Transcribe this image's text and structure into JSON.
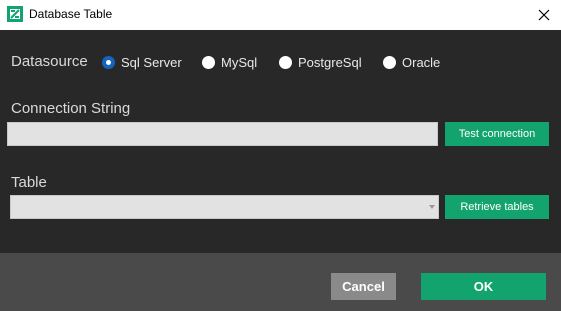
{
  "window": {
    "title": "Database Table",
    "close_icon": "close-icon",
    "app_icon": "app-logo-icon"
  },
  "datasource": {
    "label": "Datasource",
    "options": [
      {
        "label": "Sql Server",
        "checked": true
      },
      {
        "label": "MySql",
        "checked": false
      },
      {
        "label": "PostgreSql",
        "checked": false
      },
      {
        "label": "Oracle",
        "checked": false
      }
    ]
  },
  "connection": {
    "label": "Connection String",
    "value": "",
    "test_button": "Test connection"
  },
  "table": {
    "label": "Table",
    "selected": "",
    "retrieve_button": "Retrieve tables"
  },
  "footer": {
    "cancel_label": "Cancel",
    "ok_label": "OK"
  },
  "colors": {
    "accent": "#12a36f",
    "radio_checked": "#1565c0",
    "background": "#282828",
    "footer": "#4a4a4a"
  }
}
